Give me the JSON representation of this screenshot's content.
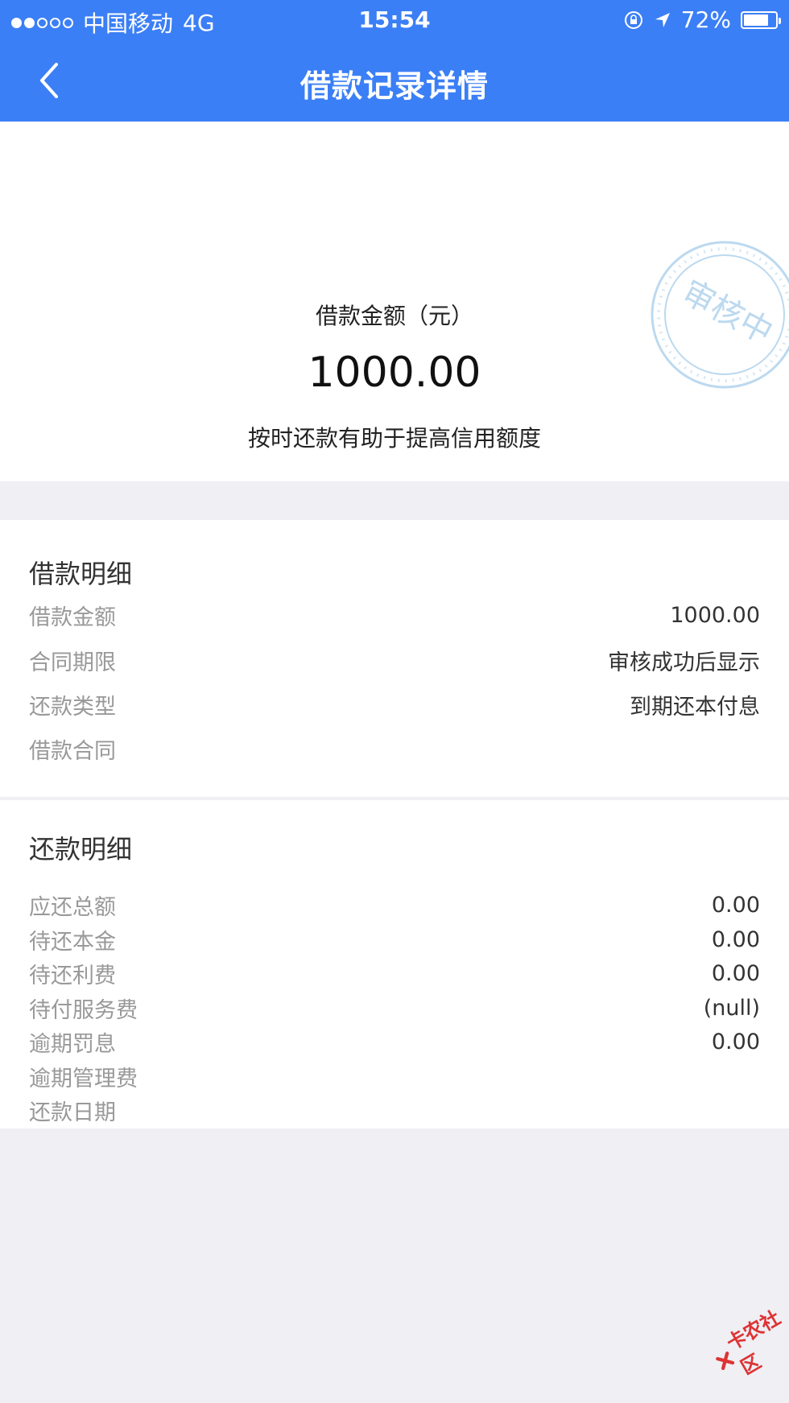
{
  "status_bar": {
    "carrier": "中国移动",
    "network": "4G",
    "time": "15:54",
    "battery": "72%"
  },
  "nav": {
    "title": "借款记录详情"
  },
  "hero": {
    "label": "借款金额（元）",
    "amount": "1000.00",
    "tip": "按时还款有助于提高信用额度",
    "stamp_text": "审核中"
  },
  "loan_detail": {
    "title": "借款明细",
    "rows": [
      {
        "label": "借款金额",
        "value": "1000.00"
      },
      {
        "label": "合同期限",
        "value": "审核成功后显示"
      },
      {
        "label": "还款类型",
        "value": "到期还本付息"
      },
      {
        "label": "借款合同",
        "value": ""
      }
    ]
  },
  "repay_detail": {
    "title": "还款明细",
    "rows": [
      {
        "label": "应还总额",
        "value": "0.00"
      },
      {
        "label": "待还本金",
        "value": "0.00"
      },
      {
        "label": "待还利费",
        "value": "0.00"
      },
      {
        "label": "待付服务费",
        "value": "(null)"
      },
      {
        "label": "逾期罚息",
        "value": "0.00"
      },
      {
        "label": "逾期管理费",
        "value": ""
      },
      {
        "label": "还款日期",
        "value": ""
      }
    ]
  },
  "watermark": "卡农社区",
  "colors": {
    "brand_blue": "#3b7ff6",
    "stamp_blue": "#bcd9ef",
    "page_bg": "#efeff4"
  }
}
